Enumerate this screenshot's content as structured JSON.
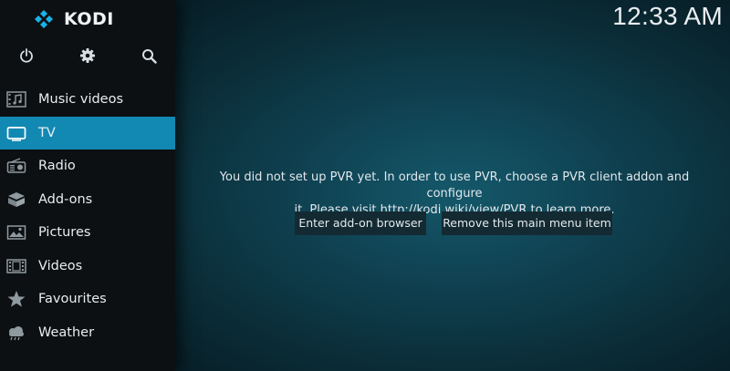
{
  "app": {
    "brand": "KODI",
    "clock": "12:33 AM"
  },
  "top_icons": [
    {
      "name": "power-icon"
    },
    {
      "name": "settings-gear-icon"
    },
    {
      "name": "search-icon"
    }
  ],
  "menu": {
    "items": [
      {
        "label": "Music videos",
        "icon": "music-video-icon",
        "active": false
      },
      {
        "label": "TV",
        "icon": "tv-icon",
        "active": true
      },
      {
        "label": "Radio",
        "icon": "radio-icon",
        "active": false
      },
      {
        "label": "Add-ons",
        "icon": "addons-box-icon",
        "active": false
      },
      {
        "label": "Pictures",
        "icon": "picture-icon",
        "active": false
      },
      {
        "label": "Videos",
        "icon": "film-strip-icon",
        "active": false
      },
      {
        "label": "Favourites",
        "icon": "star-icon",
        "active": false
      },
      {
        "label": "Weather",
        "icon": "weather-cloud-icon",
        "active": false
      }
    ]
  },
  "content": {
    "message_line1": "You did not set up PVR yet. In order to use PVR, choose a PVR client addon and configure",
    "message_line2": "it. Please visit http://kodi.wiki/view/PVR to learn more.",
    "button_addon_browser": "Enter add-on browser",
    "button_remove_item": "Remove this main menu item"
  },
  "colors": {
    "accent_active": "#1289b3",
    "kodi_logo_blue": "#17b2e7",
    "sidebar_bg": "#0d1013"
  }
}
